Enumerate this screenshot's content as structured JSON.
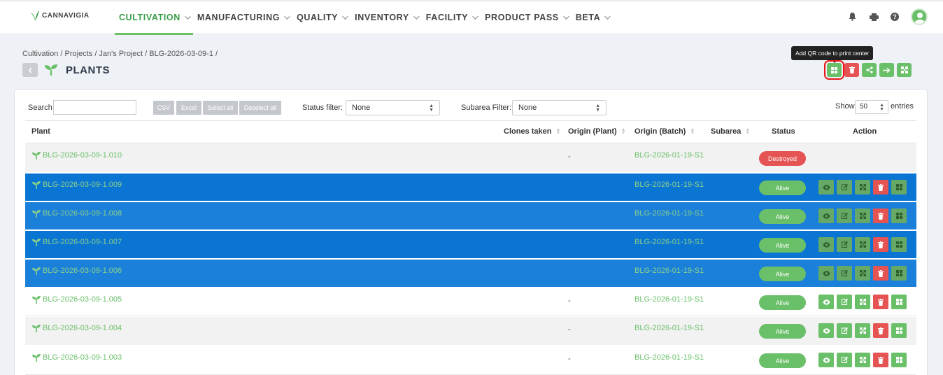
{
  "app": {
    "logo_text": "CANNAVIGIA"
  },
  "nav": {
    "items": [
      {
        "label": "CULTIVATION",
        "active": true
      },
      {
        "label": "MANUFACTURING",
        "active": false
      },
      {
        "label": "QUALITY",
        "active": false
      },
      {
        "label": "INVENTORY",
        "active": false
      },
      {
        "label": "FACILITY",
        "active": false
      },
      {
        "label": "PRODUCT PASS",
        "active": false
      },
      {
        "label": "BETA",
        "active": false
      }
    ],
    "help_label": "?"
  },
  "breadcrumb": "Cultivation / Projects / Jan's Project / BLG-2026-03-09-1 /",
  "page_title": "PLANTS",
  "tooltip": "Add QR code to print center",
  "controls": {
    "search_label": "Search",
    "search_value": "",
    "csv": "CSV",
    "excel": "Excel",
    "select_all": "Select all",
    "deselect_all": "Deselect all",
    "status_filter_label": "Status filter:",
    "status_filter_value": "None",
    "subarea_filter_label": "Subarea Filter:",
    "subarea_filter_value": "None",
    "show_label": "Show",
    "show_value": "50",
    "entries_label": "entries"
  },
  "table": {
    "headers": {
      "plant": "Plant",
      "clones_taken": "Clones taken",
      "origin_plant": "Origin (Plant)",
      "origin_batch": "Origin (Batch)",
      "subarea": "Subarea",
      "status": "Status",
      "action": "Action"
    },
    "rows": [
      {
        "plant": "BLG-2026-03-09-1.010",
        "origin_plant": "-",
        "origin_batch": "BLG-2026-01-19-S1",
        "status": "Destroyed",
        "selected": false
      },
      {
        "plant": "BLG-2026-03-09-1.009",
        "origin_plant": "",
        "origin_batch": "BLG-2026-01-19-S1",
        "status": "Alive",
        "selected": true
      },
      {
        "plant": "BLG-2026-03-09-1.008",
        "origin_plant": "",
        "origin_batch": "BLG-2026-01-19-S1",
        "status": "Alive",
        "selected": true
      },
      {
        "plant": "BLG-2026-03-09-1.007",
        "origin_plant": "",
        "origin_batch": "BLG-2026-01-19-S1",
        "status": "Alive",
        "selected": true
      },
      {
        "plant": "BLG-2026-03-09-1.006",
        "origin_plant": "-",
        "origin_batch": "BLG-2026-01-19-S1",
        "status": "Alive",
        "selected": true
      },
      {
        "plant": "BLG-2026-03-09-1.005",
        "origin_plant": "-",
        "origin_batch": "BLG-2026-01-19-S1",
        "status": "Alive",
        "selected": false
      },
      {
        "plant": "BLG-2026-03-09-1.004",
        "origin_plant": "-",
        "origin_batch": "BLG-2026-01-19-S1",
        "status": "Alive",
        "selected": false
      },
      {
        "plant": "BLG-2026-03-09-1.003",
        "origin_plant": "-",
        "origin_batch": "BLG-2026-01-19-S1",
        "status": "Alive",
        "selected": false
      }
    ]
  },
  "colors": {
    "brand_green": "#6abf69",
    "danger_red": "#e55353",
    "selection_blue": "#0b75d3",
    "highlight_red": "#e8161b"
  }
}
